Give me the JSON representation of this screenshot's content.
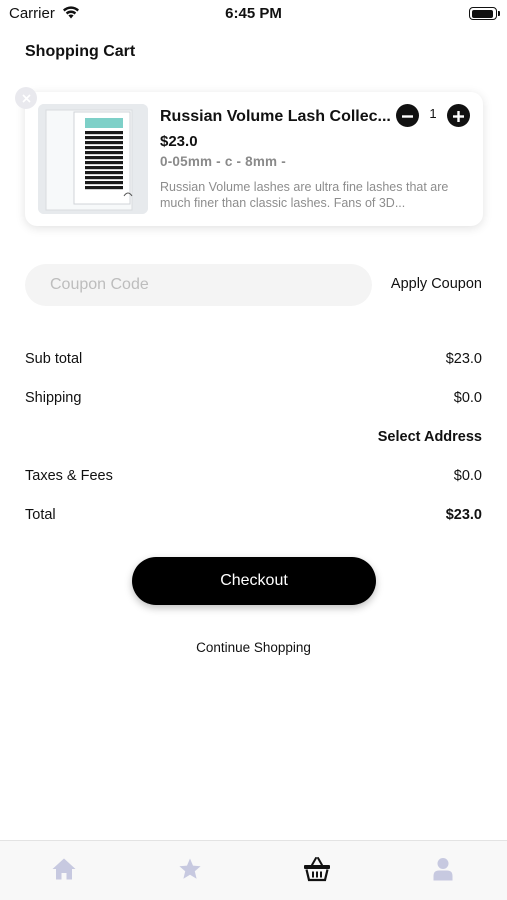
{
  "status_bar": {
    "carrier": "Carrier",
    "time": "6:45 PM"
  },
  "header": {
    "title": "Shopping Cart"
  },
  "cart": {
    "items": [
      {
        "name": "Russian Volume Lash Collec...",
        "price": "$23.0",
        "variant": "0-05mm - c - 8mm -",
        "description": "Russian Volume lashes are ultra fine lashes that are much finer than classic lashes. Fans of 3D...",
        "quantity": "1"
      }
    ]
  },
  "coupon": {
    "placeholder": "Coupon Code",
    "value": "",
    "apply_label": "Apply Coupon"
  },
  "summary": {
    "subtotal_label": "Sub total",
    "subtotal_value": "$23.0",
    "shipping_label": "Shipping",
    "shipping_value": "$0.0",
    "select_address_label": "Select Address",
    "taxes_label": "Taxes & Fees",
    "taxes_value": "$0.0",
    "total_label": "Total",
    "total_value": "$23.0"
  },
  "actions": {
    "checkout_label": "Checkout",
    "continue_label": "Continue Shopping"
  },
  "tab_bar": {
    "tabs": [
      {
        "icon": "home-icon",
        "active": false
      },
      {
        "icon": "star-icon",
        "active": false
      },
      {
        "icon": "basket-icon",
        "active": true
      },
      {
        "icon": "profile-icon",
        "active": false
      }
    ],
    "active_color": "#111111",
    "inactive_color": "#c7c9e0"
  }
}
